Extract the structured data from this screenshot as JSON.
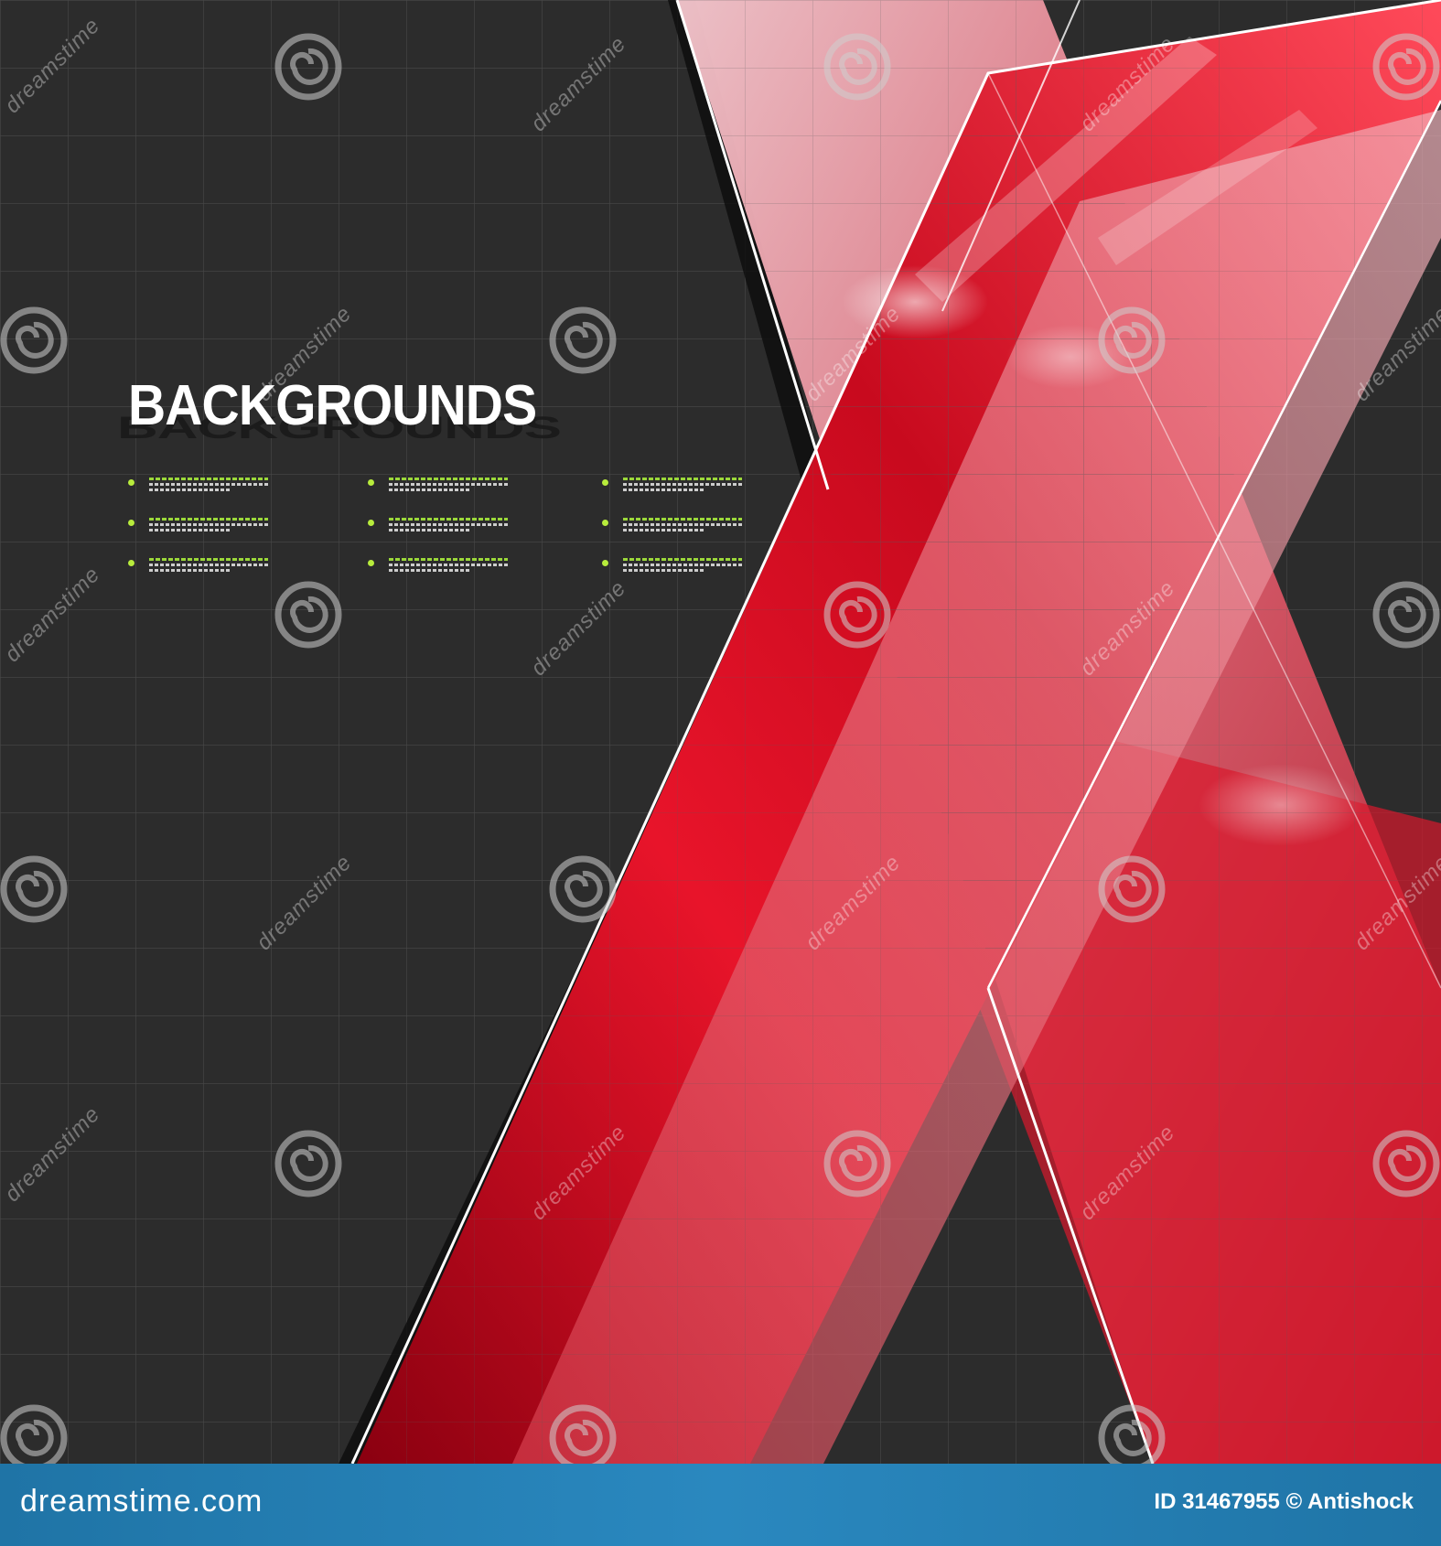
{
  "headline": "BACKGROUNDS",
  "footer": {
    "site": "dreamstime.com",
    "id_label": "ID 31467955 © Antishock"
  },
  "watermark": {
    "text": "dreamstime",
    "icon": "spiral-icon"
  },
  "bullets": {
    "count": 9,
    "dot_color": "#b8ec3c"
  },
  "colors": {
    "background": "#2c2c2c",
    "accent_red": "#e8142a",
    "footer_blue": "#2a88bf"
  }
}
